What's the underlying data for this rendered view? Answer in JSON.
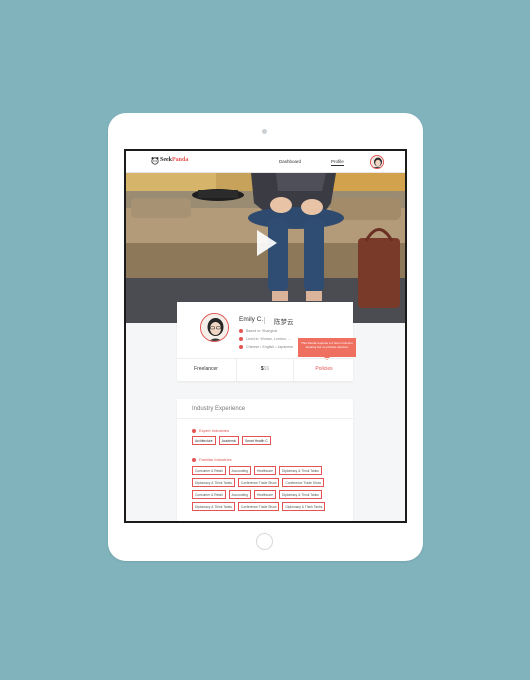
{
  "app": {
    "logo_seek": "Seek",
    "logo_panda": "Panda"
  },
  "nav": {
    "dashboard": "Dashboard",
    "profile": "Profile"
  },
  "profile": {
    "name": "Emily C.",
    "name_cn": "陈梦云",
    "based_in": "Based in: Shanghai",
    "lived_in": "Lived in: Wuhan, London, ...",
    "languages": "Chinese • English • Japanese",
    "type": "Freelancer",
    "price_active": "$",
    "price_inactive": "$$",
    "policies": "Policies",
    "tooltip": "This Panda requires a 2 hour minimum booking but no pricture sanction"
  },
  "industry": {
    "title": "Industry Experience",
    "expert_label": "Expert Industries",
    "expert_tags": [
      "Architecture",
      "Academic",
      "Smart Health C"
    ],
    "familiar_label": "Familiar Industries",
    "familiar_tags": [
      "Consumer & Retail",
      "Accounting",
      "Healthcare",
      "Diplomacy & Think Tanks",
      "Diplomacy & Think Tanks",
      "Conference Trade Show",
      "Conference Trade Show",
      "Consumer & Retail",
      "Accounting",
      "Healthcare",
      "Diplomacy & Think Tanks",
      "Diplomacy & Think Tanks",
      "Conference Trade Show",
      "Diplomacy & Think Tanks"
    ]
  },
  "colors": {
    "background": "#80b3bc",
    "accent": "#e45454",
    "tooltip": "#ef7060"
  },
  "icons": {
    "location": "map-pin-icon",
    "lived": "home-icon",
    "language": "globe-icon",
    "play": "play-icon"
  }
}
